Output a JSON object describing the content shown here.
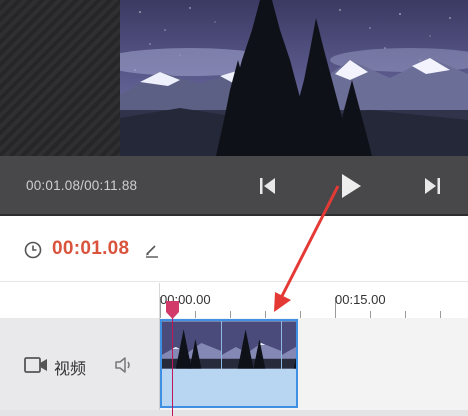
{
  "player": {
    "time_display": "00:01.08/00:11.88",
    "controls": [
      "previous-frame",
      "play",
      "next-frame"
    ]
  },
  "time_editor": {
    "current_time": "00:01.08"
  },
  "timeline": {
    "ruler_labels": [
      "00:00.00",
      "00:15.00"
    ],
    "tracks": [
      {
        "label": "视频",
        "icon": "camera-icon",
        "audio_icon": "volume-icon"
      }
    ]
  },
  "colors": {
    "accent_time": "#d9533d",
    "playhead": "#c2185b",
    "clip_border": "#3f8fe3",
    "annotation_arrow": "#e53935"
  }
}
